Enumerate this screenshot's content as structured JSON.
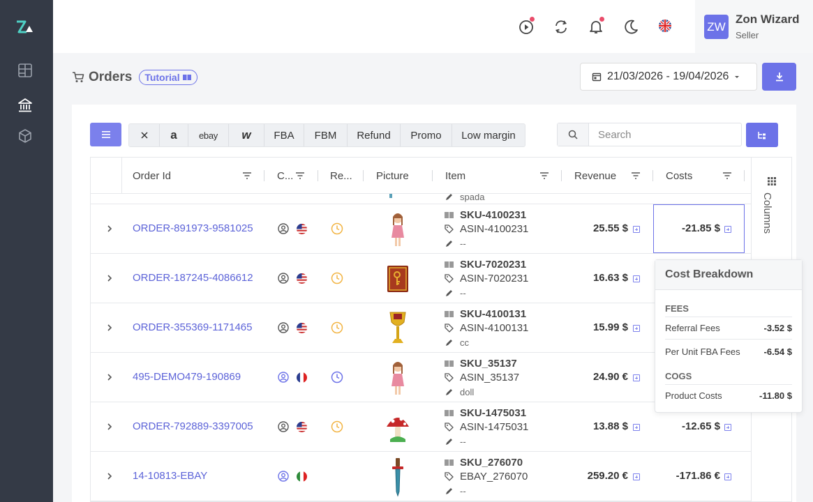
{
  "app": {
    "brand": "Zon Wizard"
  },
  "user": {
    "initials": "ZW",
    "name": "Zon Wizard",
    "role": "Seller"
  },
  "page": {
    "title": "Orders",
    "tutorial_label": "Tutorial"
  },
  "date_range": {
    "value": "21/03/2026 - 19/04/2026"
  },
  "filters": [
    {
      "label": "",
      "icon": "close-icon"
    },
    {
      "label": "a",
      "icon": "amazon-logo"
    },
    {
      "label": "ebay",
      "icon": "ebay-logo"
    },
    {
      "label": "w",
      "icon": "walmart-logo"
    },
    {
      "label": "FBA"
    },
    {
      "label": "FBM"
    },
    {
      "label": "Refund"
    },
    {
      "label": "Promo"
    },
    {
      "label": "Low margin"
    }
  ],
  "search": {
    "placeholder": "Search",
    "value": ""
  },
  "columns": {
    "order_id": "Order Id",
    "channel": "C...",
    "refund": "Re...",
    "picture": "Picture",
    "item": "Item",
    "revenue": "Revenue",
    "costs": "Costs"
  },
  "side_panel": {
    "label": "Columns"
  },
  "partial_row": {
    "note": "spada"
  },
  "rows": [
    {
      "order_id": "ORDER-891973-9581025",
      "channel": "amazon",
      "country": "US",
      "sku": "SKU-4100231",
      "asin": "ASIN-4100231",
      "note": "--",
      "revenue": "25.55 $",
      "cost": "-21.85 $",
      "picture": "doll"
    },
    {
      "order_id": "ORDER-187245-4086612",
      "channel": "amazon",
      "country": "US",
      "sku": "SKU-7020231",
      "asin": "ASIN-7020231",
      "note": "--",
      "revenue": "16.63 $",
      "cost": "",
      "picture": "book"
    },
    {
      "order_id": "ORDER-355369-1171465",
      "channel": "amazon",
      "country": "US",
      "sku": "SKU-4100131",
      "asin": "ASIN-4100131",
      "note": "cc",
      "revenue": "15.99 $",
      "cost": "",
      "picture": "chalice"
    },
    {
      "order_id": "495-DEMO479-190869",
      "channel": "amazon",
      "country": "FR",
      "sku": "SKU_35137",
      "asin": "ASIN_35137",
      "note": "doll",
      "revenue": "24.90 €",
      "cost": "",
      "picture": "doll"
    },
    {
      "order_id": "ORDER-792889-3397005",
      "channel": "amazon",
      "country": "US",
      "sku": "SKU-1475031",
      "asin": "ASIN-1475031",
      "note": "--",
      "revenue": "13.88 $",
      "cost": "-12.65 $",
      "picture": "mushroom"
    },
    {
      "order_id": "14-10813-EBAY",
      "channel": "ebay",
      "country": "IT",
      "sku": "SKU_276070",
      "asin": "EBAY_276070",
      "note": "--",
      "revenue": "259.20 €",
      "cost": "-171.86 €",
      "picture": "sword"
    }
  ],
  "cost_breakdown": {
    "title": "Cost Breakdown",
    "sections": [
      {
        "name": "FEES",
        "items": [
          {
            "label": "Referral Fees",
            "value": "-3.52 $"
          },
          {
            "label": "Per Unit FBA Fees",
            "value": "-6.54 $"
          }
        ]
      },
      {
        "name": "COGS",
        "items": [
          {
            "label": "Product Costs",
            "value": "-11.80 $"
          }
        ]
      }
    ]
  },
  "colors": {
    "accent": "#6c72e8",
    "sidebar": "#343a46",
    "link": "#5c63d8",
    "clock_yellow": "#f2b443",
    "notification": "#ea4c6a"
  }
}
